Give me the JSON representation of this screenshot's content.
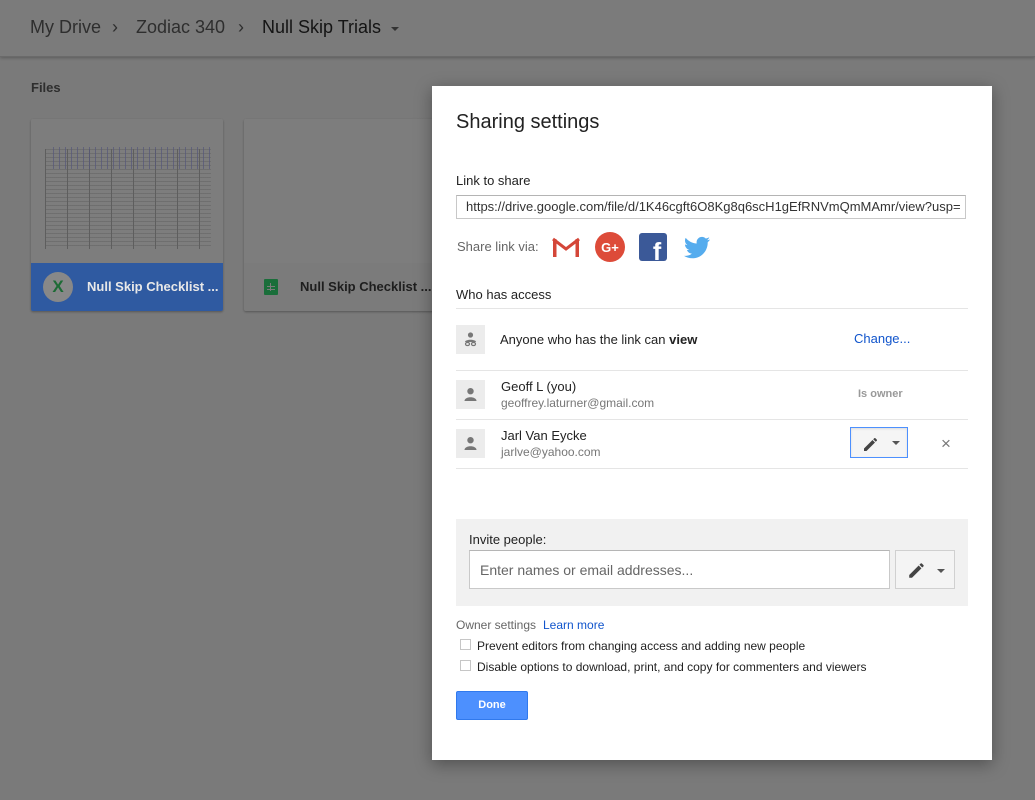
{
  "breadcrumb": {
    "items": [
      "My Drive",
      "Zodiac 340",
      "Null Skip Trials"
    ],
    "separator": ">"
  },
  "files_section": {
    "label": "Files"
  },
  "files": [
    {
      "name": "Null Skip Checklist ...",
      "type_icon": "excel-icon",
      "badge": "X",
      "selected": true
    },
    {
      "name": "Null Skip Checklist ...",
      "type_icon": "sheets-icon",
      "selected": false
    }
  ],
  "dialog": {
    "title": "Sharing settings",
    "link_label": "Link to share",
    "link_value": "https://drive.google.com/file/d/1K46cgft6O8Kg8q6scH1gEfRNVmQmMAmr/view?usp=",
    "share_via_label": "Share link via:",
    "share_services": [
      "gmail-icon",
      "google-plus-icon",
      "facebook-icon",
      "twitter-icon"
    ],
    "google_plus_text": "G+",
    "facebook_text": "f",
    "who_has_access_label": "Who has access",
    "link_access": {
      "text_prefix": "Anyone who has the link can",
      "permission": "view",
      "change_label": "Change..."
    },
    "people": [
      {
        "name": "Geoff L (you)",
        "email": "geoffrey.laturner@gmail.com",
        "role_label": "Is owner"
      },
      {
        "name": "Jarl Van Eycke",
        "email": "jarlve@yahoo.com",
        "permission_icon": "pencil-icon",
        "remove_label": "×"
      }
    ],
    "invite": {
      "label": "Invite people:",
      "placeholder": "Enter names or email addresses...",
      "permission_icon": "pencil-icon"
    },
    "owner_settings": {
      "label": "Owner settings",
      "learn_more": "Learn more",
      "options": [
        {
          "label": "Prevent editors from changing access and adding new people",
          "checked": false
        },
        {
          "label": "Disable options to download, print, and copy for commenters and viewers",
          "checked": false
        }
      ]
    },
    "done_label": "Done"
  },
  "colors": {
    "overlay": "#7a7a7a",
    "accent_blue": "#4d90fe",
    "link_blue": "#1155cc",
    "gmail_red": "#d44638",
    "google_plus_red": "#dd4b39",
    "facebook_blue": "#3b5998",
    "twitter_blue": "#55acee"
  }
}
